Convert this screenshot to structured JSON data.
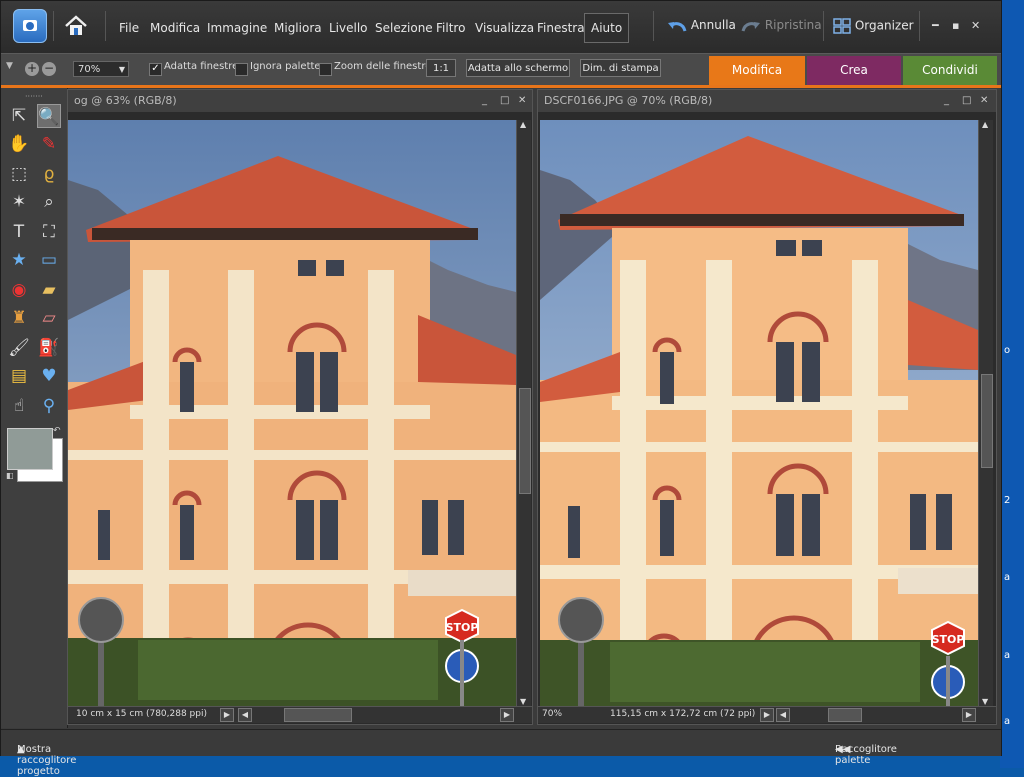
{
  "menubar": {
    "items": [
      "File",
      "Modifica",
      "Immagine",
      "Migliora",
      "Livello",
      "Selezione",
      "Filtro",
      "Visualizza",
      "Finestra",
      "Aiuto"
    ],
    "undo": "Annulla",
    "redo": "Ripristina",
    "organizer": "Organizer"
  },
  "options": {
    "zoom_value": "70%",
    "fit_windows": "Adatta finestre",
    "ignore_palettes": "Ignora palette",
    "zoom_windows": "Zoom delle finestre",
    "btn_one_to_one": "1:1",
    "btn_fit_screen": "Adatta allo schermo",
    "btn_print_size": "Dim. di stampa"
  },
  "tabs": [
    {
      "label": "Modifica",
      "color": "#e87818"
    },
    {
      "label": "Crea",
      "color": "#7e2a62"
    },
    {
      "label": "Condividi",
      "color": "#5a8a36"
    }
  ],
  "doc_left": {
    "title": "og @ 63% (RGB/8)",
    "status": "10 cm x 15 cm (780,288 ppi)"
  },
  "doc_right": {
    "title": "DSCF0166.JPG @ 70% (RGB/8)",
    "zoom": "70%",
    "status": "115,15 cm x 172,72 cm (72 ppi)"
  },
  "photo": {
    "stop_text": "STOP"
  },
  "bottom": {
    "project_bin": "Mostra raccoglitore progetto",
    "palette_bin": "Raccoglitore palette"
  },
  "desktop_glyphs": [
    "o",
    "2",
    "a",
    "a",
    "a"
  ]
}
